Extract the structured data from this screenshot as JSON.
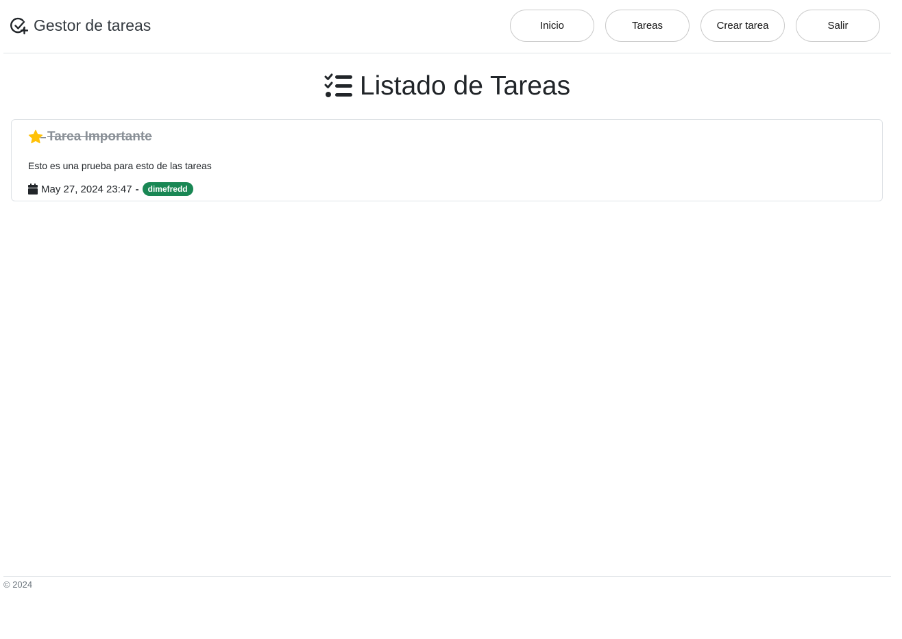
{
  "navbar": {
    "brand": "Gestor de tareas",
    "buttons": [
      "Inicio",
      "Tareas",
      "Crear tarea",
      "Salir"
    ]
  },
  "page": {
    "title": "Listado de Tareas"
  },
  "tasks": [
    {
      "title": "Tarea Importante",
      "description": "Esto es una prueba para esto de las tareas",
      "date": "May 27, 2024 23:47",
      "separator": "-",
      "user": "dimefredd",
      "important": true,
      "completed": true,
      "star_color": "#ffc107",
      "badge_color": "#198754"
    }
  ],
  "footer": {
    "text": "© 2024"
  }
}
